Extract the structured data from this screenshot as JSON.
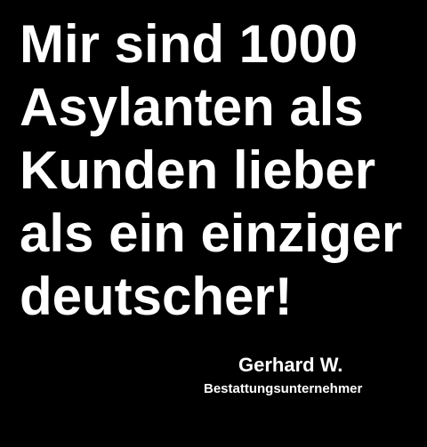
{
  "background_color": "#000000",
  "text_color": "#ffffff",
  "quote": {
    "lines": [
      "Mir sind 1000",
      "Asylanten als",
      "Kunden lieber",
      "als ein einziger",
      "deutscher!"
    ]
  },
  "attribution": {
    "name": "Gerhard W.",
    "role": "Bestattungsunternehmer"
  }
}
